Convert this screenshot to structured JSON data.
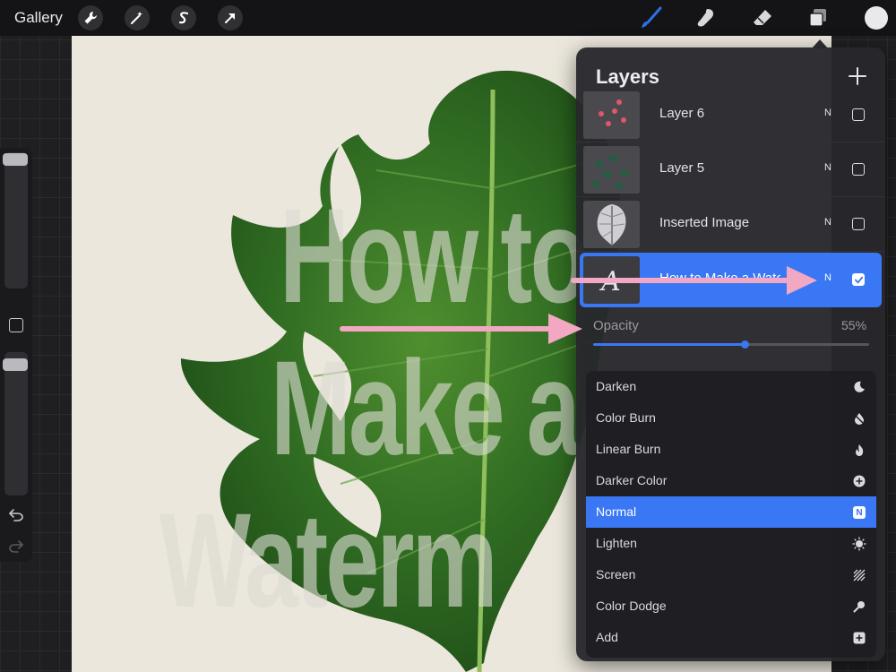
{
  "topbar": {
    "gallery_label": "Gallery",
    "tools_left": [
      "wrench-icon",
      "magic-wand-icon",
      "selection-s-icon",
      "transform-arrow-icon"
    ],
    "tools_right": [
      "brush-icon",
      "smudge-icon",
      "eraser-icon",
      "layers-icon"
    ],
    "color": "#e9e9ec",
    "active_tool_color": "#2f6fe8"
  },
  "canvas": {
    "watermark_lines": [
      "How to",
      "Make a",
      "Waterm"
    ]
  },
  "layers_panel": {
    "title": "Layers",
    "add_icon": "plus-icon",
    "layers": [
      {
        "name": "Layer 6",
        "blend": "N",
        "visible": false,
        "active": false
      },
      {
        "name": "Layer 5",
        "blend": "N",
        "visible": false,
        "active": false
      },
      {
        "name": "Inserted Image",
        "blend": "N",
        "visible": false,
        "active": false
      },
      {
        "name": "How to Make a Watermark",
        "blend": "N",
        "visible": true,
        "active": true
      }
    ],
    "opacity": {
      "label": "Opacity",
      "value_text": "55%",
      "value": 55
    }
  },
  "blend_modes": {
    "items": [
      {
        "label": "Darken",
        "icon": "moon-icon",
        "selected": false
      },
      {
        "label": "Color Burn",
        "icon": "flame-drop-icon",
        "selected": false
      },
      {
        "label": "Linear Burn",
        "icon": "flame-icon",
        "selected": false
      },
      {
        "label": "Darker Color",
        "icon": "plus-circle-icon",
        "selected": false
      },
      {
        "label": "Normal",
        "icon": "n-badge-icon",
        "badge": "N",
        "selected": true
      },
      {
        "label": "Lighten",
        "icon": "sun-icon",
        "selected": false
      },
      {
        "label": "Screen",
        "icon": "hatch-icon",
        "selected": false
      },
      {
        "label": "Color Dodge",
        "icon": "dodge-icon",
        "selected": false
      },
      {
        "label": "Add",
        "icon": "plus-square-icon",
        "selected": false
      }
    ]
  },
  "colors": {
    "accent": "#3a77f5",
    "annotation_arrow": "#f2a7c3",
    "leaf": "#2f6a22"
  }
}
